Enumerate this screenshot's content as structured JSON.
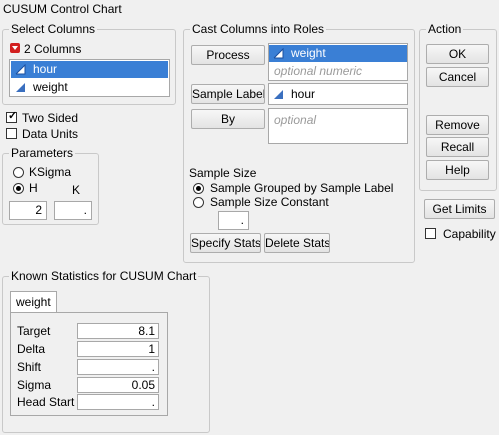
{
  "window": {
    "title": "CUSUM Control Chart"
  },
  "select_columns": {
    "legend": "Select Columns",
    "count_label": "2 Columns",
    "columns": [
      {
        "name": "hour",
        "selected": true
      },
      {
        "name": "weight",
        "selected": false
      }
    ]
  },
  "options": {
    "two_sided": {
      "label": "Two Sided",
      "checked": true
    },
    "data_units": {
      "label": "Data Units",
      "checked": false
    }
  },
  "parameters": {
    "legend": "Parameters",
    "ksigma_label": "KSigma",
    "h_label": "H",
    "k_label": "K",
    "selected": "H",
    "h_value": "2",
    "k_value": "."
  },
  "cast": {
    "legend": "Cast Columns into Roles",
    "process_button": "Process",
    "process_value": "weight",
    "process_placeholder": "optional numeric",
    "sample_label_button": "Sample Label",
    "sample_label_value": "hour",
    "by_button": "By",
    "by_placeholder": "optional",
    "sample_size_label": "Sample Size",
    "grouped_label": "Sample Grouped by Sample Label",
    "constant_label": "Sample Size Constant",
    "selected_option": "grouped",
    "constant_value": ".",
    "specify_stats_button": "Specify Stats",
    "delete_stats_button": "Delete Stats"
  },
  "action": {
    "legend": "Action",
    "ok": "OK",
    "cancel": "Cancel",
    "remove": "Remove",
    "recall": "Recall",
    "help": "Help"
  },
  "get_limits_button": "Get Limits",
  "capability": {
    "label": "Capability",
    "checked": false
  },
  "known_stats": {
    "legend": "Known Statistics for CUSUM Chart",
    "tab": "weight",
    "rows": [
      {
        "label": "Target",
        "value": "8.1"
      },
      {
        "label": "Delta",
        "value": "1"
      },
      {
        "label": "Shift",
        "value": "."
      },
      {
        "label": "Sigma",
        "value": "0.05"
      },
      {
        "label": "Head Start",
        "value": "."
      }
    ]
  },
  "colors": {
    "selection": "#3a7fd5",
    "dropdown_icon": "#d22020"
  }
}
